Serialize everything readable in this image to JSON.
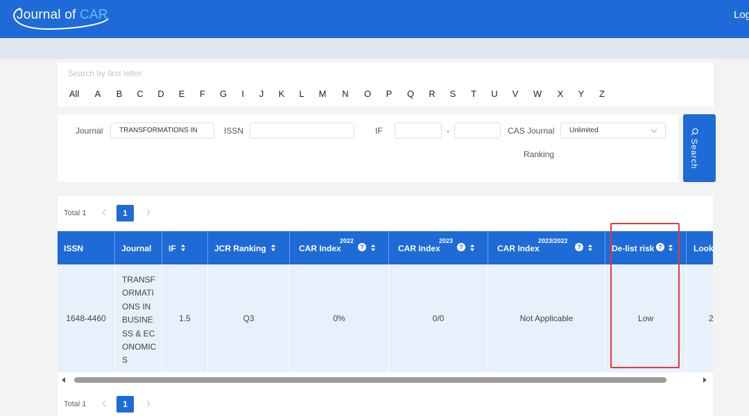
{
  "header": {
    "logo_text_1": "Journal of",
    "logo_text_2": "CAR",
    "login": "Log"
  },
  "letter_search": {
    "title": "Search by first letter",
    "letters": [
      "All",
      "A",
      "B",
      "C",
      "D",
      "E",
      "F",
      "G",
      "I",
      "J",
      "K",
      "L",
      "M",
      "N",
      "O",
      "P",
      "Q",
      "R",
      "S",
      "T",
      "U",
      "V",
      "W",
      "X",
      "Y",
      "Z"
    ]
  },
  "filters": {
    "journal_label": "Journal",
    "journal_value": "TRANSFORMATIONS IN",
    "issn_label": "ISSN",
    "issn_value": "",
    "if_label": "IF",
    "if_min": "",
    "if_dash": "-",
    "if_max": "",
    "cas_label_1": "CAS Journal",
    "cas_label_2": "Ranking",
    "cas_value": "Unlimited",
    "search_button": "Search",
    "icons": {
      "search": "search-icon",
      "dropdown": "chevron-down-icon"
    }
  },
  "pagination": {
    "total": "Total 1",
    "current_page": "1",
    "prev_icon": "chevron-left-icon",
    "next_icon": "chevron-right-icon"
  },
  "table": {
    "columns": [
      {
        "label": "ISSN",
        "sup": "",
        "sortable": false,
        "help": false
      },
      {
        "label": "Journal",
        "sup": "",
        "sortable": false,
        "help": false
      },
      {
        "label": "IF",
        "sup": "",
        "sortable": true,
        "help": false
      },
      {
        "label": "JCR Ranking",
        "sup": "",
        "sortable": true,
        "help": false
      },
      {
        "label": "CAR Index",
        "sup": "2022",
        "sortable": true,
        "help": true
      },
      {
        "label": "CAR Index",
        "sup": "2023",
        "sortable": true,
        "help": true
      },
      {
        "label": "CAR Index",
        "sup": "2023/2022",
        "sortable": true,
        "help": true
      },
      {
        "label": "De-list risk",
        "sup": "",
        "sortable": true,
        "help": true
      },
      {
        "label": "Look",
        "sup": "",
        "sortable": false,
        "help": false
      }
    ],
    "rows": [
      {
        "issn": "1648-4460",
        "journal_lines": [
          "TRANSF",
          "ORMATI",
          "ONS IN",
          "BUSINE",
          "SS & EC",
          "ONOMIC",
          "S"
        ],
        "if": "1.5",
        "jcr": "Q3",
        "car_2022": "0%",
        "car_2023": "0/0",
        "car_ratio": "Not Applicable",
        "delist_risk": "Low",
        "look": "2"
      }
    ]
  },
  "colors": {
    "primary": "#1e6ad6",
    "highlight_box": "#e53935",
    "row_bg": "#e8f0fb"
  }
}
